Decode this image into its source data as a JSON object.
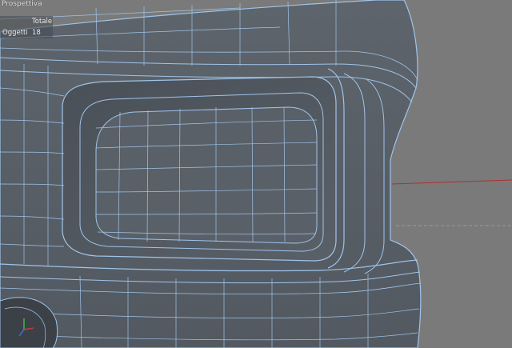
{
  "viewport": {
    "title": "Prospettiva",
    "stats": {
      "total_header": "Totale",
      "objects_label": "Oggetti",
      "objects_value": "18"
    }
  },
  "colors": {
    "background": "#7a7a7a",
    "mesh_fill": "#5a6068",
    "wireframe": "#9fc4ea",
    "x_axis": "#c43c3c",
    "y_axis": "#3fb84a",
    "z_axis": "#3a6cd8"
  },
  "icons": [
    "axis-gizmo-icon"
  ]
}
